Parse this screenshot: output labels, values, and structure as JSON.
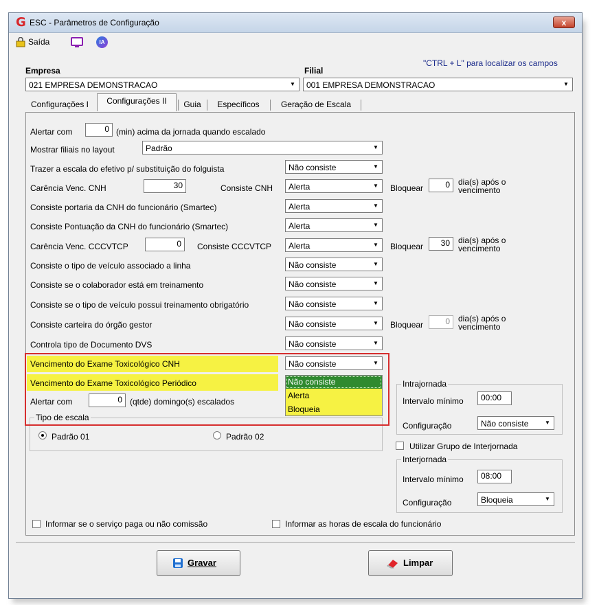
{
  "window": {
    "title": "ESC - Parâmetros de Configuração",
    "close_label": "x"
  },
  "toolbar": {
    "exit_label": "Saída",
    "ia_label": "IA"
  },
  "hint": "\"CTRL + L\" para localizar os campos",
  "empresa": {
    "label": "Empresa",
    "value": "021 EMPRESA DEMONSTRACAO"
  },
  "filial": {
    "label": "Filial",
    "value": "001 EMPRESA DEMONSTRACAO"
  },
  "tabs": [
    "Configurações I",
    "Configurações II",
    "Guia",
    "Específicos",
    "Geração de Escala"
  ],
  "active_tab": "Configurações II",
  "rows": {
    "alertar1": {
      "label": "Alertar com",
      "value": "0",
      "suffix": "(min) acima da jornada quando escalado"
    },
    "filiais": {
      "label": "Mostrar filiais no layout",
      "value": "Padrão"
    },
    "trazer": {
      "label": "Trazer a escala do efetivo p/ substituição do folguista",
      "value": "Não consiste"
    },
    "carencia_cnh": {
      "label": "Carência Venc. CNH",
      "value": "30",
      "consiste_label": "Consiste CNH",
      "consiste_value": "Alerta",
      "bloquear_label": "Bloquear",
      "bloquear_value": "0",
      "dias_label": "dia(s) após o vencimento"
    },
    "portaria": {
      "label": "Consiste portaria da CNH do funcionário (Smartec)",
      "value": "Alerta"
    },
    "pontuacao": {
      "label": "Consiste Pontuação da CNH do funcionário (Smartec)",
      "value": "Alerta"
    },
    "carencia_cccv": {
      "label": "Carência Venc. CCCVTCP",
      "value": "0",
      "consiste_label": "Consiste CCCVTCP",
      "consiste_value": "Alerta",
      "bloquear_label": "Bloquear",
      "bloquear_value": "30",
      "dias_label": "dia(s) após o vencimento"
    },
    "tipo_veiculo": {
      "label": "Consiste o tipo de veículo associado a linha",
      "value": "Não consiste"
    },
    "treinamento": {
      "label": "Consiste se o colaborador está em treinamento",
      "value": "Não consiste"
    },
    "veiculo_trein": {
      "label": "Consiste se o tipo de veículo possui treinamento obrigatório",
      "value": "Não consiste"
    },
    "carteira": {
      "label": "Consiste carteira do órgão gestor",
      "value": "Não consiste",
      "bloquear_label": "Bloquear",
      "bloquear_value": "0",
      "dias_label": "dia(s) após o vencimento"
    },
    "dvs": {
      "label": "Controla tipo de Documento DVS",
      "value": "Não consiste"
    },
    "toxico_cnh": {
      "label": "Vencimento do Exame Toxicológico CNH",
      "value": "Não consiste"
    },
    "toxico_periodico": {
      "label": "Vencimento do Exame Toxicológico Periódico"
    },
    "alertar2": {
      "label": "Alertar com",
      "value": "0",
      "suffix": "(qtde) domingo(s) escalados"
    }
  },
  "dropdown_options": [
    "Não consiste",
    "Alerta",
    "Bloqueia"
  ],
  "dropdown_selected": "Não consiste",
  "tipo_escala": {
    "title": "Tipo de escala",
    "options": [
      "Padrão 01",
      "Padrão 02"
    ],
    "selected": "Padrão 01"
  },
  "intrajornada": {
    "title": "Intrajornada",
    "intervalo_label": "Intervalo mínimo",
    "intervalo_value": "00:00",
    "config_label": "Configuração",
    "config_value": "Não consiste"
  },
  "grupo_interjornada": {
    "label": "Utilizar Grupo de Interjornada",
    "checked": false
  },
  "interjornada": {
    "title": "Interjornada",
    "intervalo_label": "Intervalo mínimo",
    "intervalo_value": "08:00",
    "config_label": "Configuração",
    "config_value": "Bloqueia"
  },
  "comissao": {
    "label": "Informar se o serviço paga ou não comissão",
    "checked": false
  },
  "horas_escala": {
    "label": "Informar as horas de escala do funcionário",
    "checked": false
  },
  "buttons": {
    "save": "Gravar",
    "clear": "Limpar"
  },
  "colors": {
    "highlight": "#f6f243",
    "dropdown_selected": "#2f8a2f",
    "annotation_border": "#d62e2e",
    "hint": "#1a2a8a"
  }
}
